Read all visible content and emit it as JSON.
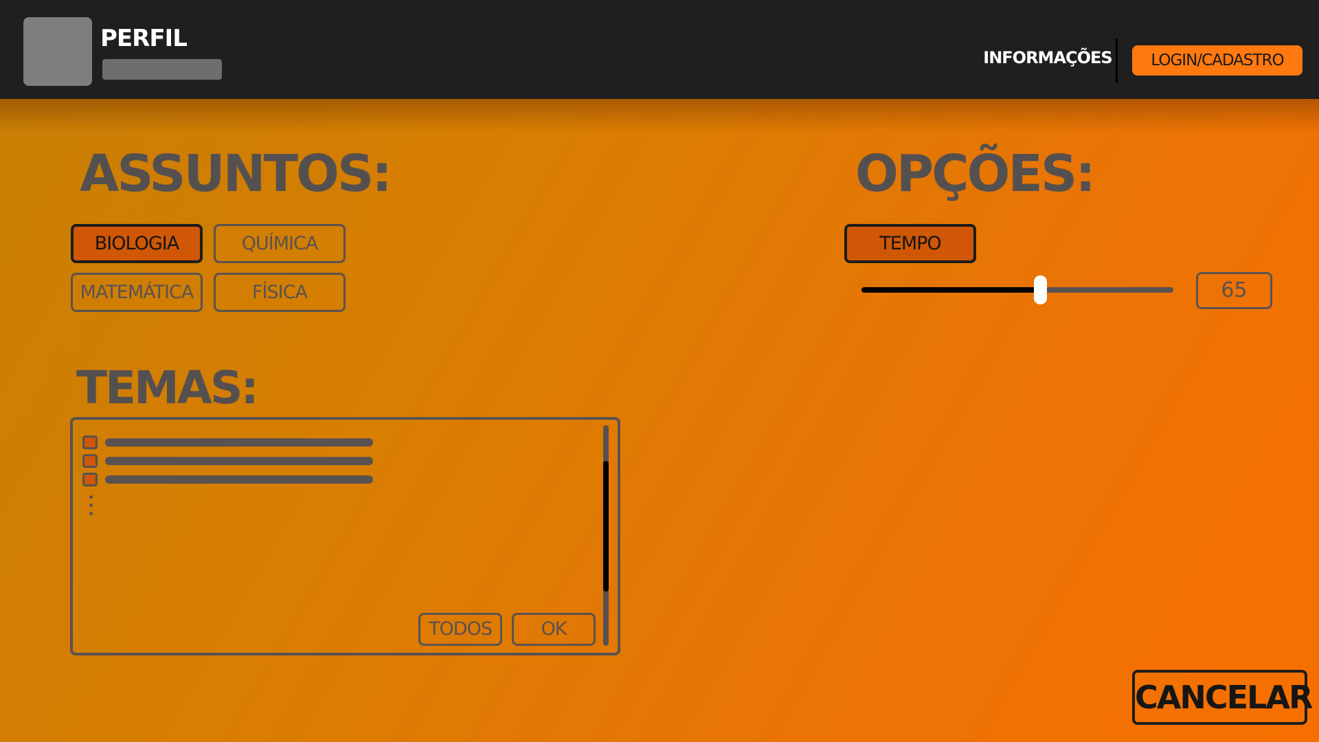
{
  "header": {
    "profile_name": "PERFIL",
    "nav_info": "INFORMAÇÕES",
    "login_label": "LOGIN/CADASTRO"
  },
  "subjects": {
    "title": "ASSUNTOS:",
    "items": [
      {
        "label": "BIOLOGIA",
        "selected": true
      },
      {
        "label": "QUÍMICA",
        "selected": false
      },
      {
        "label": "MATEMÁTICA",
        "selected": false
      },
      {
        "label": "FÍSICA",
        "selected": false
      }
    ]
  },
  "themes": {
    "title": "TEMAS:",
    "all_label": "TODOS",
    "ok_label": "OK"
  },
  "options": {
    "title": "OPÇÕES:",
    "time_label": "TEMPO",
    "time_value": "65"
  },
  "footer": {
    "cancel_label": "CANCELAR"
  },
  "colors": {
    "accent_orange": "#ff7810",
    "selected_chip": "#cf5705",
    "header_bg": "#1f1f1f",
    "text_gray": "#5a5250"
  }
}
